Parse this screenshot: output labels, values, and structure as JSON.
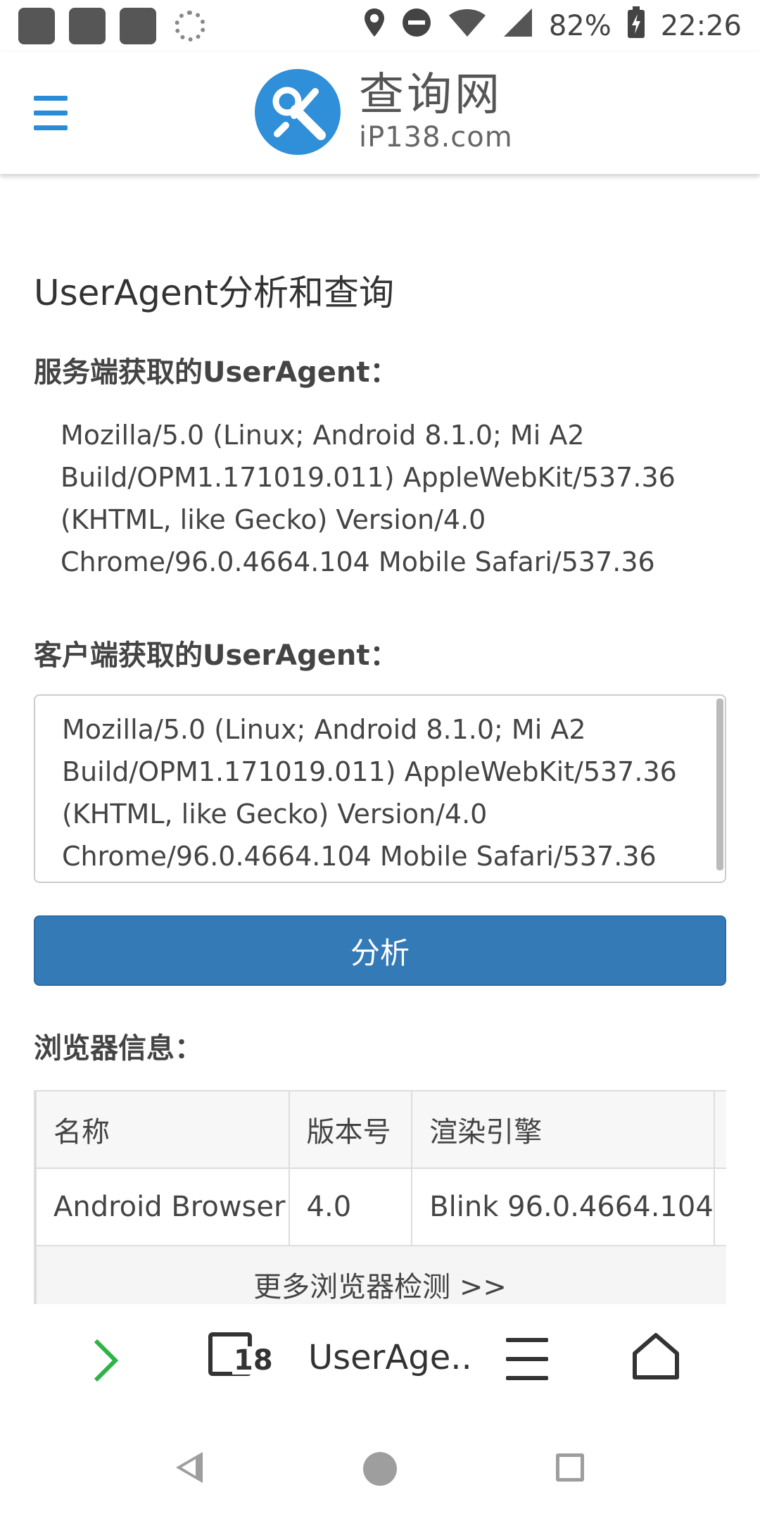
{
  "status_bar": {
    "battery": "82%",
    "time": "22:26"
  },
  "header": {
    "logo_icon": "wrench-icon",
    "logo_cn": "查询网",
    "logo_en": "iP138.com"
  },
  "page": {
    "title": "UserAgent分析和查询",
    "server_label": "服务端获取的UserAgent：",
    "server_ua": "Mozilla/5.0 (Linux; Android 8.1.0; Mi A2 Build/OPM1.171019.011) AppleWebKit/537.36 (KHTML, like Gecko) Version/4.0 Chrome/96.0.4664.104 Mobile Safari/537.36",
    "client_label": "客户端获取的UserAgent：",
    "client_ua": "Mozilla/5.0 (Linux; Android 8.1.0; Mi A2 Build/OPM1.171019.011) AppleWebKit/537.36 (KHTML, like Gecko) Version/4.0 Chrome/96.0.4664.104 Mobile Safari/537.36",
    "analyze_button": "分析",
    "browser_label": "浏览器信息："
  },
  "browser_table": {
    "headers": [
      "名称",
      "版本号",
      "渲染引擎",
      ""
    ],
    "row": [
      "Android Browser",
      "4.0",
      "Blink 96.0.4664.104",
      ""
    ],
    "more_link": "更多浏览器检测 >>"
  },
  "toolbar": {
    "forward_icon": "chevron-right-icon",
    "tab_count": "18",
    "page_title": "UserAge..",
    "menu_icon": "menu-icon",
    "home_icon": "home-icon"
  },
  "navbar": {
    "back_icon": "back-triangle-icon",
    "home_icon": "home-circle-icon",
    "recents_icon": "recents-square-icon"
  }
}
